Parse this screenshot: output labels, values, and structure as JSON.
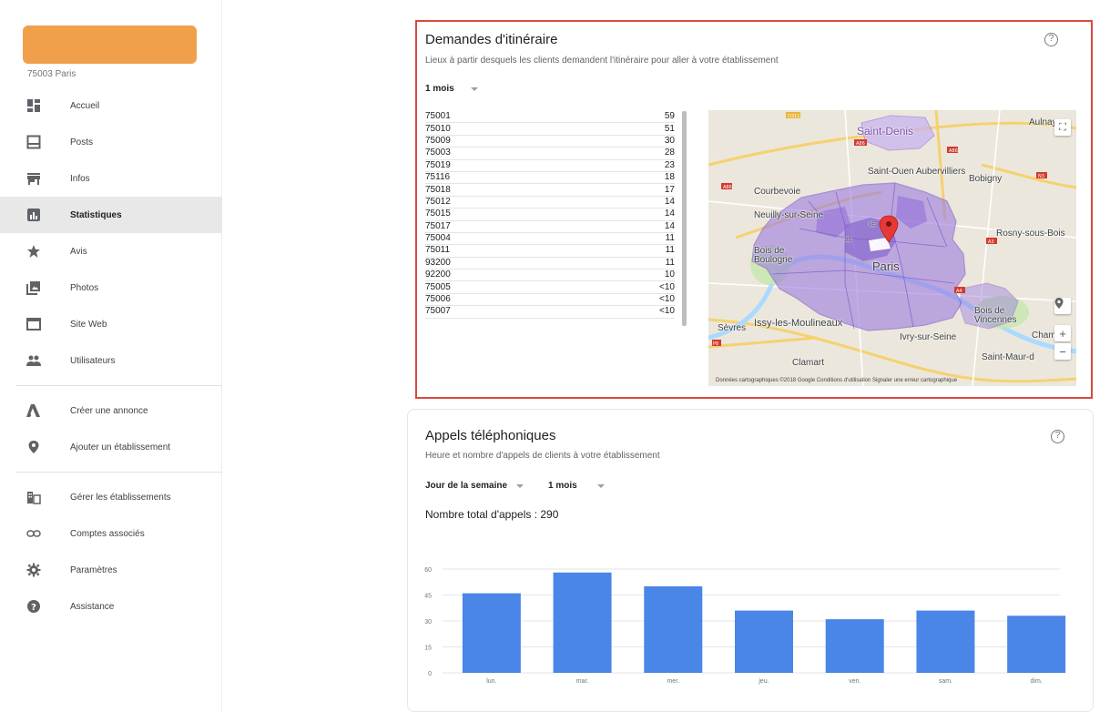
{
  "sidebar": {
    "address": "75003 Paris",
    "items": [
      {
        "label": "Accueil",
        "icon": "dashboard-icon"
      },
      {
        "label": "Posts",
        "icon": "posts-icon"
      },
      {
        "label": "Infos",
        "icon": "store-icon"
      },
      {
        "label": "Statistiques",
        "icon": "insights-icon",
        "active": true
      },
      {
        "label": "Avis",
        "icon": "star-icon"
      },
      {
        "label": "Photos",
        "icon": "photos-icon"
      },
      {
        "label": "Site Web",
        "icon": "website-icon"
      },
      {
        "label": "Utilisateurs",
        "icon": "users-icon"
      }
    ],
    "items2": [
      {
        "label": "Créer une annonce",
        "icon": "ads-icon"
      },
      {
        "label": "Ajouter un établissement",
        "icon": "location-pin-icon"
      }
    ],
    "items3": [
      {
        "label": "Gérer les établissements",
        "icon": "buildings-icon"
      },
      {
        "label": "Comptes associés",
        "icon": "link-icon"
      },
      {
        "label": "Paramètres",
        "icon": "gear-icon"
      },
      {
        "label": "Assistance",
        "icon": "help-icon"
      }
    ]
  },
  "directions": {
    "title": "Demandes d'itinéraire",
    "subtitle": "Lieux à partir desquels les clients demandent l'itinéraire pour aller à votre établissement",
    "period": "1 mois",
    "rows": [
      {
        "zip": "75001",
        "count": "59"
      },
      {
        "zip": "75010",
        "count": "51"
      },
      {
        "zip": "75009",
        "count": "30"
      },
      {
        "zip": "75003",
        "count": "28"
      },
      {
        "zip": "75019",
        "count": "23"
      },
      {
        "zip": "75116",
        "count": "18"
      },
      {
        "zip": "75018",
        "count": "17"
      },
      {
        "zip": "75012",
        "count": "14"
      },
      {
        "zip": "75015",
        "count": "14"
      },
      {
        "zip": "75017",
        "count": "14"
      },
      {
        "zip": "75004",
        "count": "11"
      },
      {
        "zip": "75011",
        "count": "11"
      },
      {
        "zip": "93200",
        "count": "11"
      },
      {
        "zip": "92200",
        "count": "10"
      },
      {
        "zip": "75005",
        "count": "<10"
      },
      {
        "zip": "75006",
        "count": "<10"
      },
      {
        "zip": "75007",
        "count": "<10"
      }
    ],
    "map": {
      "labels": {
        "saint_denis": "Saint-Denis",
        "aulnay": "Aulnay-",
        "aubervilliers": "Saint-Ouen Aubervilliers",
        "bobigny": "Bobigny",
        "courbevoie": "Courbevoie",
        "neuilly": "Neuilly-sur-Seine",
        "rosny": "Rosny-sous-Bois",
        "bois_boulogne": "Bois de Boulogne",
        "paris": "Paris",
        "bois_vincennes": "Bois de Vincennes",
        "issy": "Issy-les-Moulineaux",
        "sevres": "Sèvres",
        "ivry": "Ivry-sur-Seine",
        "champigny": "Cham",
        "clamart": "Clamart",
        "saint_maur": "Saint-Maur-d",
        "arr_8": "8E",
        "arr_9": "9E"
      },
      "attribution": "Données cartographiques ©2018 Google   Conditions d'utilisation   Signaler une erreur cartographique"
    }
  },
  "calls": {
    "title": "Appels téléphoniques",
    "subtitle": "Heure et nombre d'appels de clients à votre établissement",
    "dropdown_day": "Jour de la semaine",
    "dropdown_period": "1 mois",
    "total_label": "Nombre total d'appels : 290"
  },
  "chart_data": {
    "type": "bar",
    "categories": [
      "lun.",
      "mar.",
      "mer.",
      "jeu.",
      "ven.",
      "sam.",
      "dim."
    ],
    "values": [
      46,
      58,
      50,
      36,
      31,
      36,
      33
    ],
    "yticks": [
      0,
      15,
      30,
      45,
      60
    ],
    "ylim": [
      0,
      60
    ],
    "color": "#4a86e8",
    "grid": true
  },
  "colors": {
    "accent": "#f0a04b",
    "highlight_border": "#d9483e",
    "bar": "#4a86e8",
    "map_region": "#9b7be0"
  }
}
